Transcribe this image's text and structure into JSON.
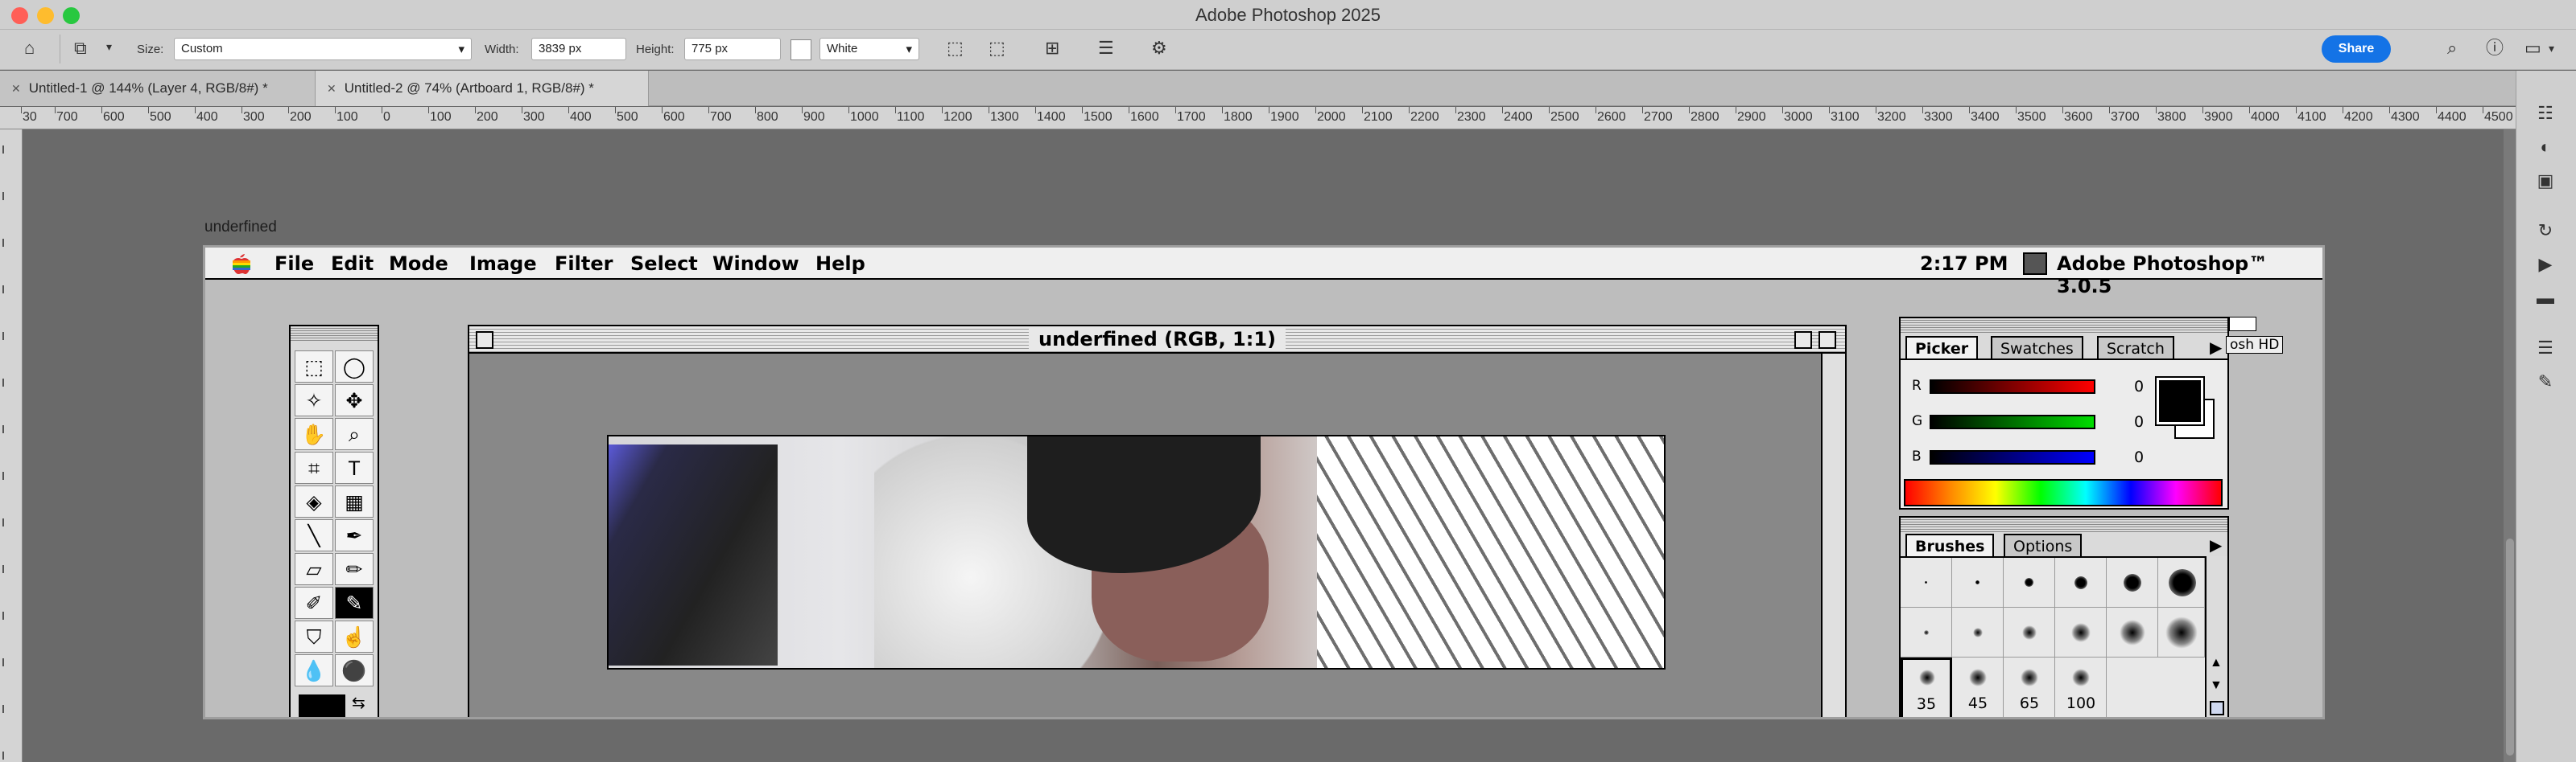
{
  "app": {
    "title": "Adobe Photoshop 2025"
  },
  "options_bar": {
    "size_label": "Size:",
    "size_value": "Custom",
    "width_label": "Width:",
    "width_value": "3839 px",
    "height_label": "Height:",
    "height_value": "775 px",
    "fill_value": "White",
    "share_label": "Share"
  },
  "tabs": [
    {
      "label": "Untitled-1 @ 144% (Layer 4, RGB/8#) *"
    },
    {
      "label": "Untitled-2 @ 74% (Artboard 1, RGB/8#) *"
    }
  ],
  "ruler": {
    "ticks": [
      "30",
      "700",
      "600",
      "500",
      "400",
      "300",
      "200",
      "100",
      "0",
      "100",
      "200",
      "300",
      "400",
      "500",
      "600",
      "700",
      "800",
      "900",
      "1000",
      "1100",
      "1200",
      "1300",
      "1400",
      "1500",
      "1600",
      "1700",
      "1800",
      "1900",
      "2000",
      "2100",
      "2200",
      "2300",
      "2400",
      "2500",
      "2600",
      "2700",
      "2800",
      "2900",
      "3000",
      "3100",
      "3200",
      "3300",
      "3400",
      "3500",
      "3600",
      "3700",
      "3800",
      "3900",
      "4000",
      "4100",
      "4200",
      "4300",
      "4400",
      "4500"
    ]
  },
  "artboard": {
    "label": "underfined"
  },
  "classic": {
    "menus": [
      "File",
      "Edit",
      "Mode",
      "Image",
      "Filter",
      "Select",
      "Window",
      "Help"
    ],
    "time": "2:17 PM",
    "app_name": "Adobe Photoshop™ 3.0.5",
    "doc_title": "underfined  (RGB, 1:1)",
    "disk_label": "osh HD",
    "picker": {
      "tabs": [
        "Picker",
        "Swatches",
        "Scratch"
      ],
      "r_label": "R",
      "g_label": "G",
      "b_label": "B",
      "r_value": "0",
      "g_value": "0",
      "b_value": "0"
    },
    "brushes": {
      "tabs": [
        "Brushes",
        "Options"
      ],
      "sizes": [
        "35",
        "45",
        "65",
        "100"
      ]
    }
  },
  "colors": {
    "accent": "#1473e6",
    "workspace": "#6a6a6a"
  }
}
